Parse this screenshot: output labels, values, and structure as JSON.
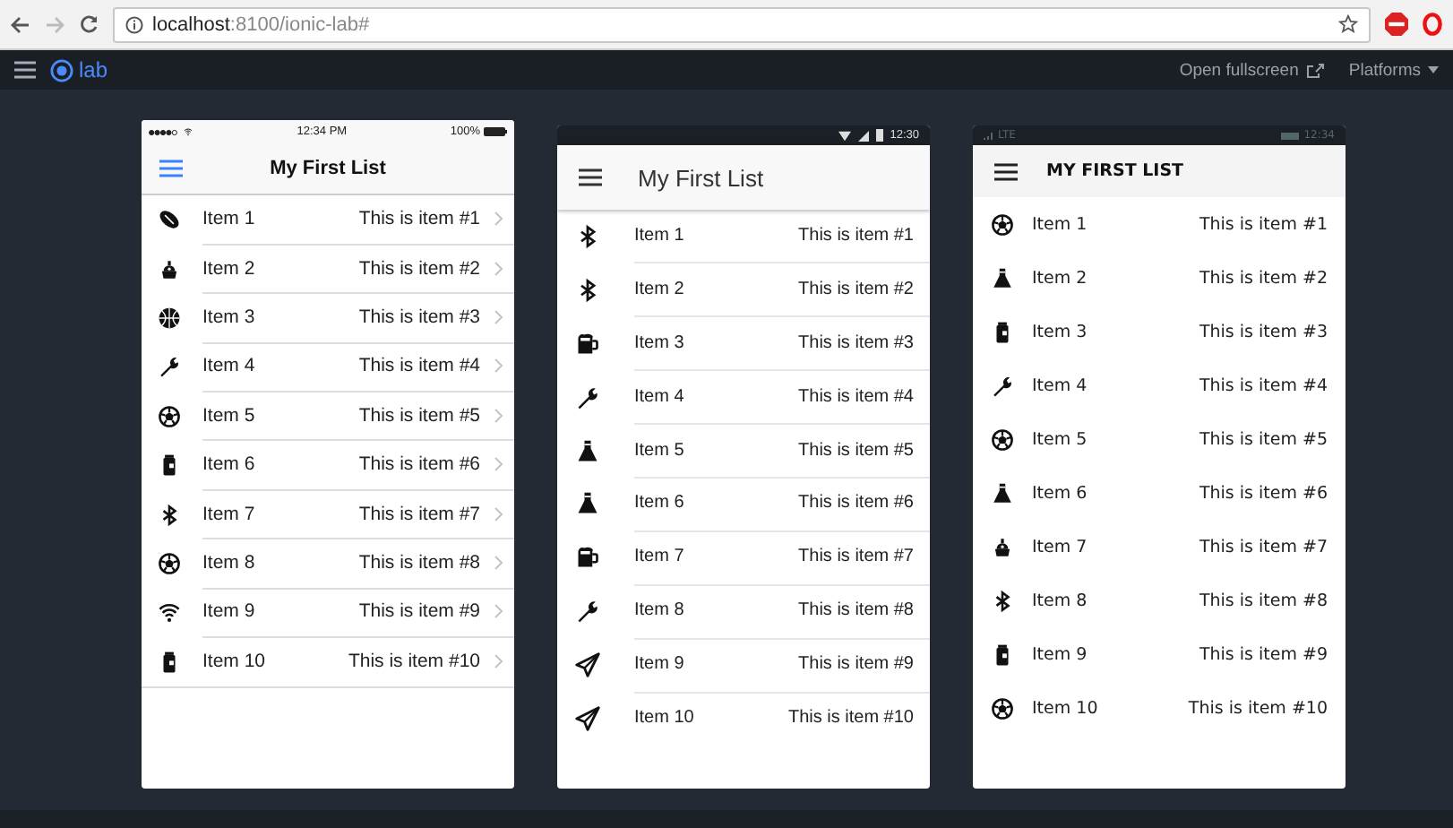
{
  "browser": {
    "url": "**localhost**:8100/ionic-lab#"
  },
  "lab_bar": {
    "logo": "lab",
    "fullscreen": "Open fullscreen",
    "platforms": "Platforms"
  },
  "phones": [
    {
      "kind": "ios",
      "status_bar": {
        "time": "12:34 PM",
        "battery": "100%"
      },
      "title": "My First List",
      "items": [
        {
          "title": "Item 1",
          "note": "This is item #1"
        },
        {
          "title": "Item 2",
          "note": "This is item #2"
        },
        {
          "title": "Item 3",
          "note": "This is item #3"
        },
        {
          "title": "Item 4",
          "note": "This is item #4"
        },
        {
          "title": "Item 5",
          "note": "This is item #5"
        },
        {
          "title": "Item 6",
          "note": "This is item #6"
        },
        {
          "title": "Item 7",
          "note": "This is item #7"
        },
        {
          "title": "Item 8",
          "note": "This is item #8"
        },
        {
          "title": "Item 9",
          "note": "This is item #9"
        },
        {
          "title": "Item 10",
          "note": "This is item #10"
        }
      ]
    },
    {
      "kind": "android",
      "status_bar": {
        "time": "12:30"
      },
      "title": "My First List",
      "items": [
        {
          "title": "Item 1",
          "note": "This is item #1"
        },
        {
          "title": "Item 2",
          "note": "This is item #2"
        },
        {
          "title": "Item 3",
          "note": "This is item #3"
        },
        {
          "title": "Item 4",
          "note": "This is item #4"
        },
        {
          "title": "Item 5",
          "note": "This is item #5"
        },
        {
          "title": "Item 6",
          "note": "This is item #6"
        },
        {
          "title": "Item 7",
          "note": "This is item #7"
        },
        {
          "title": "Item 8",
          "note": "This is item #8"
        },
        {
          "title": "Item 9",
          "note": "This is item #9"
        },
        {
          "title": "Item 10",
          "note": "This is item #10"
        }
      ]
    },
    {
      "kind": "windows",
      "status_bar": {
        "network": "LTE",
        "time": "12:34"
      },
      "title": "MY FIRST LIST",
      "items": [
        {
          "title": "Item 1",
          "note": "This is item #1"
        },
        {
          "title": "Item 2",
          "note": "This is item #2"
        },
        {
          "title": "Item 3",
          "note": "This is item #3"
        },
        {
          "title": "Item 4",
          "note": "This is item #4"
        },
        {
          "title": "Item 5",
          "note": "This is item #5"
        },
        {
          "title": "Item 6",
          "note": "This is item #6"
        },
        {
          "title": "Item 7",
          "note": "This is item #7"
        },
        {
          "title": "Item 8",
          "note": "This is item #8"
        },
        {
          "title": "Item 9",
          "note": "This is item #9"
        },
        {
          "title": "Item 10",
          "note": "This is item #10"
        }
      ]
    }
  ]
}
